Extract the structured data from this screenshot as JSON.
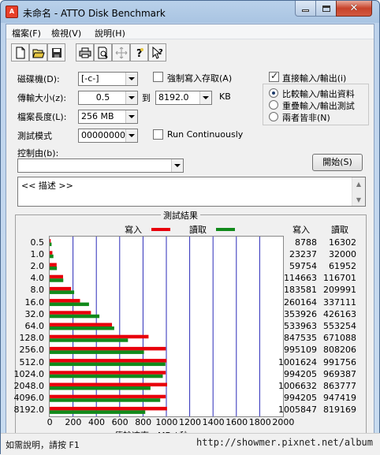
{
  "window": {
    "title": "未命名 - ATTO Disk Benchmark",
    "app_icon_text": "A"
  },
  "menu": [
    "檔案(F)",
    "檢視(V)",
    "說明(H)"
  ],
  "toolbar": {
    "icons": [
      "new-file-icon",
      "open-file-icon",
      "save-icon",
      "print-icon",
      "print-preview-icon",
      "move-icon",
      "help-icon",
      "context-help-icon"
    ]
  },
  "settings": {
    "drive_label": "磁碟機(D):",
    "drive_value": "[-c-]",
    "transfer_size_label": "傳輸大小(z):",
    "transfer_from": "0.5",
    "transfer_to_label": "到",
    "transfer_to": "8192.0",
    "transfer_unit": "KB",
    "file_length_label": "檔案長度(L):",
    "file_length": "256 MB",
    "test_pattern_label": "測試模式",
    "test_pattern": "00000000",
    "controlled_by_label": "控制由(b):",
    "controlled_by": "",
    "force_write_label": "強制寫入存取(A)",
    "force_write_checked": false,
    "run_continuously_label": "Run Continuously",
    "run_continuously_checked": false,
    "direct_io_label": "直接輸入/輸出(i)",
    "direct_io_checked": true,
    "mode_options": [
      "比較輸入/輸出資料",
      "重疊輸入/輸出測試",
      "兩者皆非(N)"
    ],
    "mode_selected": 0,
    "start_button": "開始(S)",
    "description": "<< 描述 >>"
  },
  "results": {
    "title": "測試結果",
    "write_col": "寫入",
    "read_col": "讀取",
    "write_color": "#e8000b",
    "read_color": "#118a1b"
  },
  "chart_data": {
    "type": "bar",
    "orientation": "horizontal",
    "xlabel": "傳輸速率 - MB / 秒",
    "xlim": [
      0,
      2000
    ],
    "xticks": [
      0,
      200,
      400,
      600,
      800,
      1000,
      1200,
      1400,
      1600,
      1800,
      2000
    ],
    "categories": [
      "0.5",
      "1.0",
      "2.0",
      "4.0",
      "8.0",
      "16.0",
      "32.0",
      "64.0",
      "128.0",
      "256.0",
      "512.0",
      "1024.0",
      "2048.0",
      "4096.0",
      "8192.0"
    ],
    "series": [
      {
        "name": "寫入",
        "values": [
          8.788,
          23.237,
          59.754,
          114.663,
          183.581,
          260.164,
          353.926,
          533.963,
          847.535,
          995.109,
          1001.624,
          994.205,
          1006.632,
          994.205,
          1005.847
        ]
      },
      {
        "name": "讀取",
        "values": [
          16.302,
          32.0,
          61.952,
          116.701,
          209.991,
          337.111,
          426.163,
          553.254,
          671.088,
          808.206,
          991.756,
          969.387,
          863.777,
          947.419,
          819.169
        ]
      }
    ],
    "write_table": [
      "8788",
      "23237",
      "59754",
      "114663",
      "183581",
      "260164",
      "353926",
      "533963",
      "847535",
      "995109",
      "1001624",
      "994205",
      "1006632",
      "994205",
      "1005847"
    ],
    "read_table": [
      "16302",
      "32000",
      "61952",
      "116701",
      "209991",
      "337111",
      "426163",
      "553254",
      "671088",
      "808206",
      "991756",
      "969387",
      "863777",
      "947419",
      "819169"
    ]
  },
  "status": {
    "text": "如需說明，請按 F1",
    "watermark": "http://showmer.pixnet.net/album"
  }
}
